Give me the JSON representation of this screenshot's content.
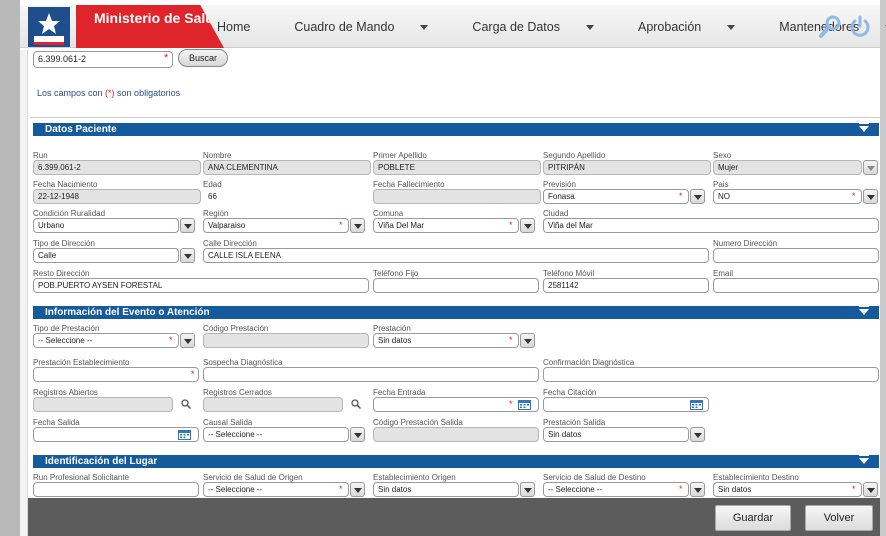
{
  "header": {
    "brand": "Ministerio de Salud",
    "nav": [
      {
        "label": "Home",
        "dropdown": false
      },
      {
        "label": "Cuadro de Mando",
        "dropdown": true
      },
      {
        "label": "Carga de Datos",
        "dropdown": true
      },
      {
        "label": "Aprobación",
        "dropdown": true
      },
      {
        "label": "Mantenedores",
        "dropdown": true
      }
    ],
    "icons": [
      "search-icon",
      "power-icon"
    ]
  },
  "search": {
    "value": "6.399.061-2",
    "button": "Buscar"
  },
  "note": {
    "before": "Los campos con ",
    "marker": "(*)",
    "after": " son obligatorios"
  },
  "sections": {
    "paciente": "Datos Paciente",
    "evento": "Información del Evento o Atención",
    "lugar": "Identificación del Lugar"
  },
  "paciente": {
    "run": {
      "label": "Run",
      "value": "6.399.061-2"
    },
    "nombre": {
      "label": "Nombre",
      "value": "ANA CLEMENTINA"
    },
    "primer_apellido": {
      "label": "Primer Apellido",
      "value": "POBLETE"
    },
    "segundo_apellido": {
      "label": "Segundo Apellido",
      "value": "PITRIPÁN"
    },
    "sexo": {
      "label": "Sexo",
      "value": "Mujer"
    },
    "fecha_nacimiento": {
      "label": "Fecha Nacimiento",
      "value": "22-12-1948"
    },
    "edad": {
      "label": "Edad",
      "value": "66"
    },
    "fecha_fallecimiento": {
      "label": "Fecha Fallecimiento",
      "value": ""
    },
    "prevision": {
      "label": "Previsión",
      "value": "Fonasa"
    },
    "pais": {
      "label": "Pais",
      "value": "NO"
    },
    "condicion": {
      "label": "Condición Ruralidad",
      "value": "Urbano"
    },
    "region": {
      "label": "Región",
      "value": "Valparaiso"
    },
    "comuna": {
      "label": "Comuna",
      "value": "Viña Del Mar"
    },
    "ciudad": {
      "label": "Ciudad",
      "value": "Viña del Mar"
    },
    "tipo_direccion": {
      "label": "Tipo de Dirección",
      "value": "Calle"
    },
    "calle_direccion": {
      "label": "Calle Dirección",
      "value": "CALLE ISLA ELENA"
    },
    "numero_direccion": {
      "label": "Numero Dirección",
      "value": ""
    },
    "resto_direccion": {
      "label": "Resto Dirección",
      "value": "POB.PUERTO AYSEN FORESTAL"
    },
    "telefono_fijo": {
      "label": "Teléfono Fijo",
      "value": ""
    },
    "telefono_movil": {
      "label": "Teléfono Móvil",
      "value": "2581142"
    },
    "email": {
      "label": "Email",
      "value": ""
    }
  },
  "evento": {
    "tipo_prestacion": {
      "label": "Tipo de Prestación",
      "value": "-- Seleccione --"
    },
    "codigo_prestacion": {
      "label": "Código Prestación",
      "value": ""
    },
    "prestacion": {
      "label": "Prestación",
      "value": "Sin datos"
    },
    "prestacion_establecimiento": {
      "label": "Prestación Establecimiento",
      "value": ""
    },
    "sospecha": {
      "label": "Sospecha Diagnóstica",
      "value": ""
    },
    "confirmacion": {
      "label": "Confirmación Diagnóstica",
      "value": ""
    },
    "registros_abiertos": {
      "label": "Registros Abiertos",
      "value": ""
    },
    "registros_cerrados": {
      "label": "Registros Cerrados",
      "value": ""
    },
    "fecha_entrada": {
      "label": "Fecha Entrada",
      "value": ""
    },
    "fecha_citacion": {
      "label": "Fecha Citación",
      "value": ""
    },
    "fecha_salida": {
      "label": "Fecha Salida",
      "value": ""
    },
    "causal_salida": {
      "label": "Causal Salida",
      "value": "-- Seleccione --"
    },
    "codigo_prestacion_salida": {
      "label": "Código Prestación Salida",
      "value": ""
    },
    "prestacion_salida": {
      "label": "Prestación Salida",
      "value": "Sin datos"
    }
  },
  "lugar": {
    "run_profesional": {
      "label": "Run Profesional Solicitante",
      "value": ""
    },
    "servicio_origen": {
      "label": "Servicio de Salud de Origen",
      "value": "-- Seleccione --"
    },
    "establecimiento_origen": {
      "label": "Establecimiento Origen",
      "value": "Sin datos"
    },
    "servicio_destino": {
      "label": "Servicio de Salud de Destino",
      "value": "-- Seleccione --"
    },
    "establecimiento_destino": {
      "label": "Establecimiento Destino",
      "value": "Sin datos"
    }
  },
  "footer": {
    "guardar": "Guardar",
    "volver": "Volver"
  },
  "colors": {
    "brand_red": "#e0242c",
    "section_blue": "#155a9c",
    "required": "#e02020"
  }
}
